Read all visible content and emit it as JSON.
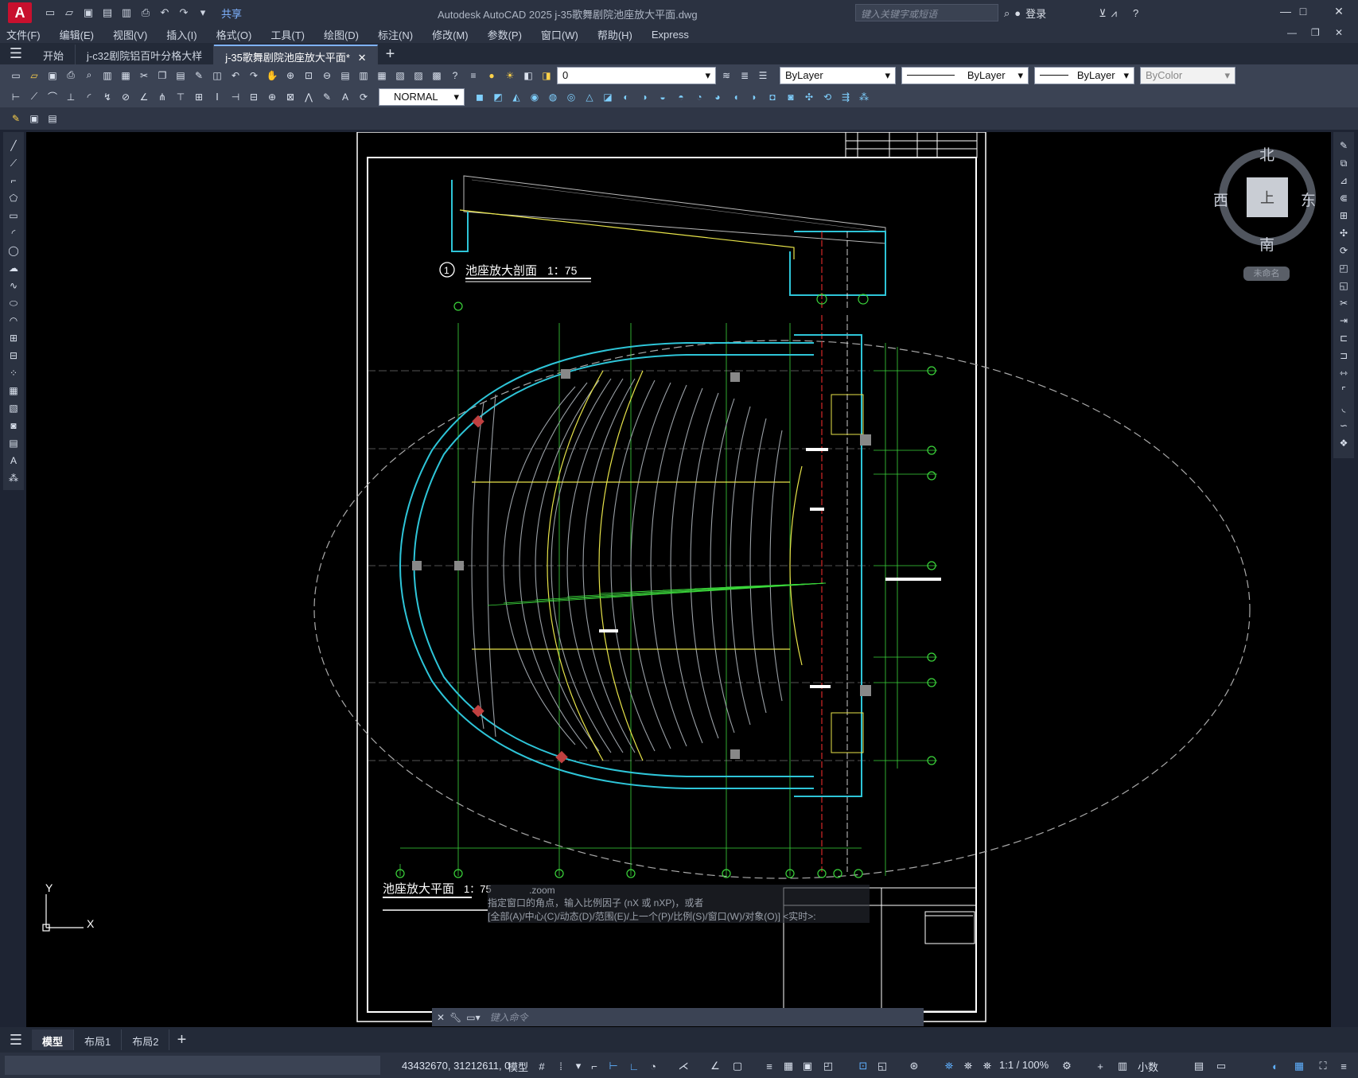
{
  "app": {
    "title": "Autodesk AutoCAD 2025    j-35歌舞剧院池座放大平面.dwg",
    "logo_letter": "A",
    "share_label": "共享",
    "search_placeholder": "键入关键字或短语",
    "login_label": "登录"
  },
  "menu": [
    "文件(F)",
    "编辑(E)",
    "视图(V)",
    "插入(I)",
    "格式(O)",
    "工具(T)",
    "绘图(D)",
    "标注(N)",
    "修改(M)",
    "参数(P)",
    "窗口(W)",
    "帮助(H)",
    "Express"
  ],
  "file_tabs": [
    {
      "label": "开始",
      "active": false
    },
    {
      "label": "j-c32剧院铝百叶分格大样",
      "active": false
    },
    {
      "label": "j-35歌舞剧院池座放大平面*",
      "active": true
    }
  ],
  "toolbar": {
    "layer_value": "0",
    "color_value": "ByLayer",
    "linetype_value": "ByLayer",
    "lineweight_value": "ByLayer",
    "plotstyle_value": "ByColor",
    "dimstyle_value": "NORMAL"
  },
  "viewcube": {
    "north": "北",
    "south": "南",
    "west": "西",
    "east": "东",
    "top_face": "上",
    "named_view": "未命名"
  },
  "drawing": {
    "section_number": "1",
    "section_title": "池座放大剖面",
    "section_scale": "1：75",
    "plan_title": "池座放大平面",
    "plan_scale": "1：75"
  },
  "command": {
    "history_line1": ".zoom",
    "history_line2": "指定窗口的角点，输入比例因子 (nX 或 nXP)，或者",
    "history_line3": "[全部(A)/中心(C)/动态(D)/范围(E)/上一个(P)/比例(S)/窗口(W)/对象(O)] <实时>:",
    "input_placeholder": "键入命令"
  },
  "layout_tabs": [
    {
      "label": "模型",
      "active": true
    },
    {
      "label": "布局1",
      "active": false
    },
    {
      "label": "布局2",
      "active": false
    }
  ],
  "status": {
    "coordinates": "43432670, 31212611, 0",
    "model_label": "模型",
    "annotation_scale": "1:1 / 100%",
    "units": "小数"
  },
  "ucs": {
    "x": "X",
    "y": "Y"
  }
}
